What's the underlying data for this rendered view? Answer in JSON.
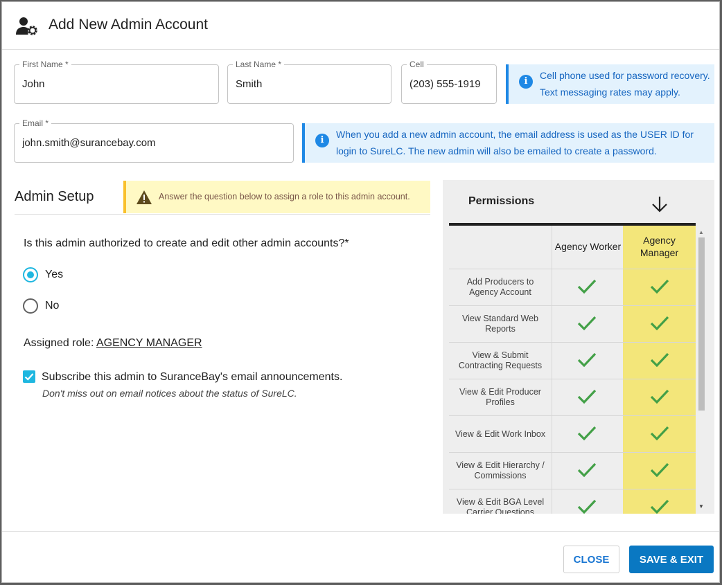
{
  "dialog": {
    "title": "Add New Admin Account",
    "icon": "user-gear-icon"
  },
  "fields": {
    "first_name": {
      "label": "First Name *",
      "value": "John"
    },
    "last_name": {
      "label": "Last Name *",
      "value": "Smith"
    },
    "cell": {
      "label": "Cell",
      "value": "(203) 555-1919"
    },
    "email": {
      "label": "Email *",
      "value": "john.smith@surancebay.com"
    }
  },
  "info": {
    "cell_line1": "Cell phone used for password recovery.",
    "cell_line2": "Text messaging rates may apply.",
    "email_line1": "When you add a new admin account, the email address is used as the USER ID for",
    "email_line2": "login to SureLC. The new admin will also be emailed to create a password."
  },
  "admin_setup": {
    "title": "Admin Setup",
    "warning": "Answer the question below to assign a role to this admin account.",
    "question": "Is this admin authorized to create and edit other admin accounts?*",
    "options": [
      {
        "label": "Yes",
        "selected": true
      },
      {
        "label": "No",
        "selected": false
      }
    ],
    "assigned_role_label": "Assigned role:",
    "assigned_role_value": "AGENCY MANAGER",
    "subscribe_label": "Subscribe this admin to SuranceBay's email announcements.",
    "subscribe_checked": true,
    "subscribe_note": "Don't miss out on email notices about the status of SureLC."
  },
  "permissions": {
    "title": "Permissions",
    "col_a": "Agency Worker",
    "col_b_line1": "Agency",
    "col_b_line2": "Manager",
    "rows": [
      {
        "line1": "Add Producers to",
        "line2": "Agency Account"
      },
      {
        "line1": "View Standard Web",
        "line2": "Reports"
      },
      {
        "line1": "View & Submit",
        "line2": "Contracting Requests"
      },
      {
        "line1": "View & Edit Producer",
        "line2": "Profiles"
      },
      {
        "line1": "View & Edit Work Inbox",
        "line2": ""
      },
      {
        "line1": "View & Edit Hierarchy /",
        "line2": "Commissions"
      },
      {
        "line1": "View & Edit BGA Level",
        "line2": "Carrier Questions"
      }
    ]
  },
  "footer": {
    "close_label": "CLOSE",
    "save_label": "SAVE & EXIT"
  },
  "colors": {
    "accent": "#0a78c2",
    "radio": "#1fb7e0",
    "check": "#43a047",
    "highlight": "#f3e67a",
    "info_bg": "#e3f2fd",
    "warn_bg": "#fff9c4"
  }
}
